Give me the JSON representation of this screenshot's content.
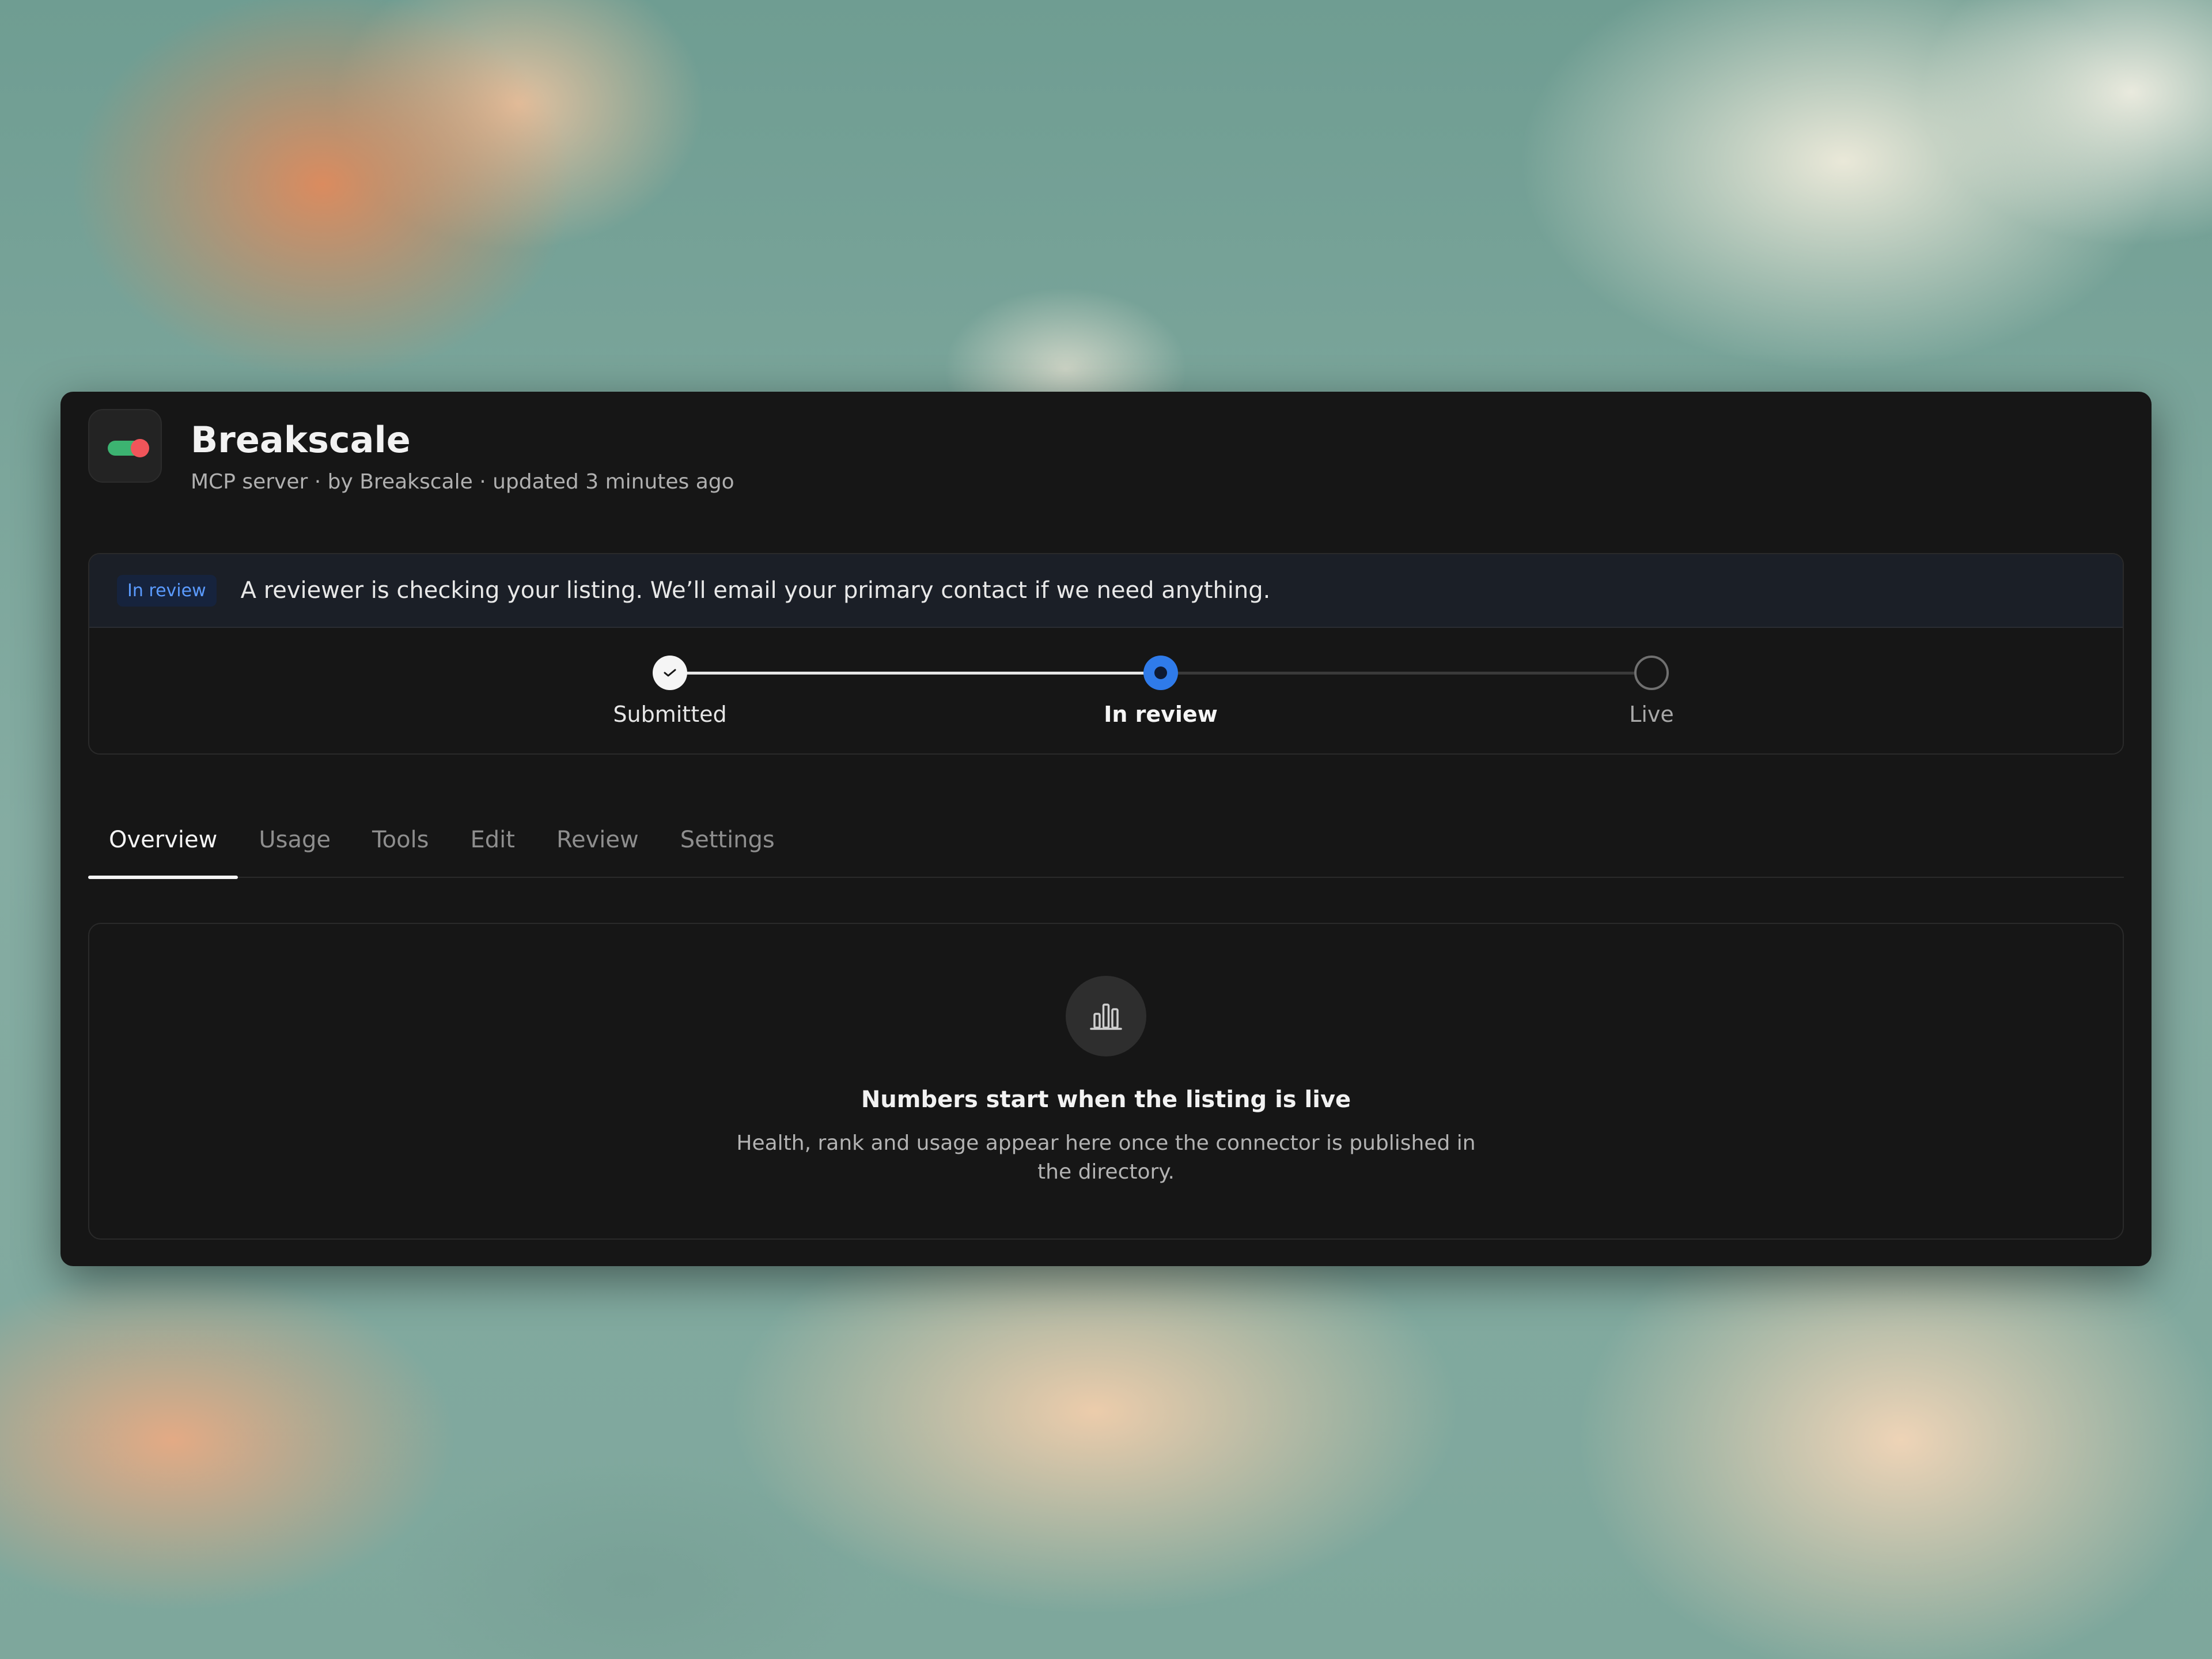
{
  "app": {
    "name": "Breakscale",
    "meta": "MCP server · by Breakscale · updated 3 minutes ago",
    "icon": "toggle-switch-icon"
  },
  "status": {
    "badge": "In review",
    "message": "A reviewer is checking your listing. We’ll email your primary contact if we need anything.",
    "steps": [
      {
        "label": "Submitted",
        "state": "done"
      },
      {
        "label": "In review",
        "state": "current"
      },
      {
        "label": "Live",
        "state": "pending"
      }
    ]
  },
  "tabs": [
    {
      "label": "Overview",
      "active": true
    },
    {
      "label": "Usage",
      "active": false
    },
    {
      "label": "Tools",
      "active": false
    },
    {
      "label": "Edit",
      "active": false
    },
    {
      "label": "Review",
      "active": false
    },
    {
      "label": "Settings",
      "active": false
    }
  ],
  "empty_state": {
    "icon": "bar-chart-icon",
    "title": "Numbers start when the listing is live",
    "description": "Health, rank and usage appear here once the connector is published in the directory."
  },
  "colors": {
    "accent": "#2f7bea",
    "badge_text": "#5b9bff",
    "window_bg": "#161616",
    "toggle_on": "#3cb371",
    "toggle_knob": "#f0555a"
  }
}
